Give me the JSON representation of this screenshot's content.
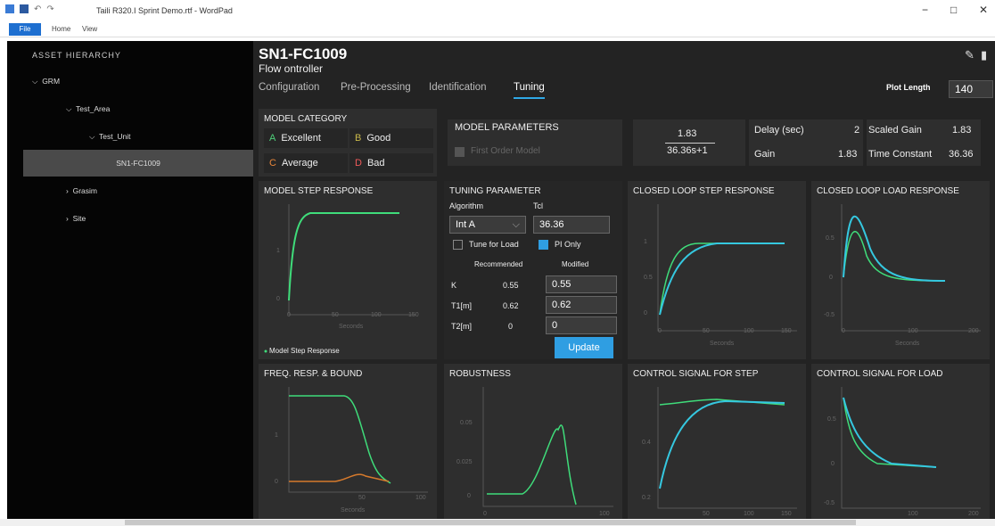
{
  "window": {
    "title": "Taili R320.I Sprint Demo.rtf - WordPad",
    "file": "File",
    "home": "Home",
    "view": "View",
    "min": "−",
    "max": "□",
    "close": "✕"
  },
  "sidebar": {
    "header": "ASSET HIERARCHY",
    "items": [
      {
        "label": "GRM"
      },
      {
        "label": "Test_Area"
      },
      {
        "label": "Test_Unit"
      },
      {
        "label": "SN1-FC1009"
      },
      {
        "label": "Grasim"
      },
      {
        "label": "Site"
      }
    ]
  },
  "page": {
    "title": "SN1-FC1009",
    "subtitle": "Flow ontroller"
  },
  "tabs": [
    "Configuration",
    "Pre-Processing",
    "Identification",
    "Tuning"
  ],
  "plot_length": {
    "label": "Plot Length",
    "value": "140"
  },
  "model_category": {
    "title": "MODEL CATEGORY",
    "items": [
      {
        "letter": "A",
        "label": "Excellent",
        "color": "#4fd07a"
      },
      {
        "letter": "B",
        "label": "Good",
        "color": "#c8b84a"
      },
      {
        "letter": "C",
        "label": "Average",
        "color": "#e8863a"
      },
      {
        "letter": "D",
        "label": "Bad",
        "color": "#f05a5a"
      }
    ]
  },
  "model_parameters": {
    "title": "MODEL PARAMETERS",
    "checkbox": "First Order Model"
  },
  "transfer": {
    "num": "1.83",
    "den": "36.36s+1"
  },
  "params": {
    "delay_label": "Delay (sec)",
    "delay": "2",
    "gain_label": "Gain",
    "gain": "1.83",
    "scaled_gain_label": "Scaled Gain",
    "scaled_gain": "1.83",
    "tc_label": "Time Constant",
    "tc": "36.36"
  },
  "tuning": {
    "title": "TUNING PARAMETER",
    "algorithm_label": "Algorithm",
    "tcl_label": "Tcl",
    "algorithm": "Int A",
    "tcl": "36.36",
    "tune_load": "Tune for Load",
    "pi_only": "PI Only",
    "recommended": "Recommended",
    "modified": "Modified",
    "rows": [
      {
        "label": "K",
        "rec": "0.55",
        "mod": "0.55"
      },
      {
        "label": "T1[m]",
        "rec": "0.62",
        "mod": "0.62"
      },
      {
        "label": "T2[m]",
        "rec": "0",
        "mod": "0"
      }
    ],
    "update": "Update"
  },
  "charts": {
    "step": {
      "title": "MODEL STEP RESPONSE",
      "legend": "Model Step Response"
    },
    "cl_step": {
      "title": "CLOSED LOOP STEP RESPONSE"
    },
    "cl_load": {
      "title": "CLOSED LOOP LOAD RESPONSE"
    },
    "freq": {
      "title": "FREQ. RESP. & BOUND"
    },
    "robust": {
      "title": "ROBUSTNESS"
    },
    "cs_step": {
      "title": "CONTROL SIGNAL FOR STEP"
    },
    "cs_load": {
      "title": "CONTROL SIGNAL FOR LOAD"
    }
  },
  "colors": {
    "green": "#3fdc7a",
    "cyan": "#35c8e0",
    "orange": "#d67a2c",
    "accent": "#2f9ee2"
  }
}
